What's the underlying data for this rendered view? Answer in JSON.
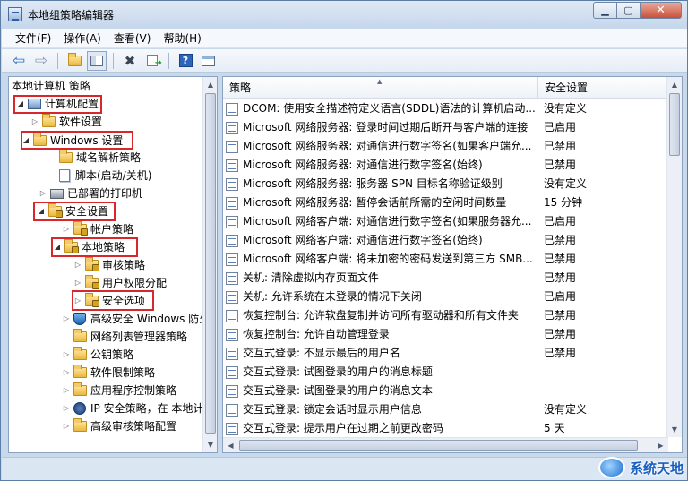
{
  "window": {
    "title": "本地组策略编辑器"
  },
  "menu": [
    "文件(F)",
    "操作(A)",
    "查看(V)",
    "帮助(H)"
  ],
  "toolbar_icons": [
    "back-arrow-icon",
    "forward-arrow-icon",
    "up-folder-icon",
    "show-hide-tree-icon",
    "delete-icon",
    "export-list-icon",
    "help-icon",
    "properties-icon"
  ],
  "tree": {
    "root": "本地计算机 策略",
    "computer_config": "计算机配置",
    "software_settings": "软件设置",
    "windows_settings": "Windows 设置",
    "dns_policy": "域名解析策略",
    "scripts": "脚本(启动/关机)",
    "printers": "已部署的打印机",
    "security_settings": "安全设置",
    "account_policies": "帐户策略",
    "local_policies": "本地策略",
    "audit_policy": "审核策略",
    "user_rights": "用户权限分配",
    "security_options": "安全选项",
    "firewall": "高级安全 Windows 防火",
    "network_list": "网络列表管理器策略",
    "public_key": "公钥策略",
    "software_restriction": "软件限制策略",
    "app_control": "应用程序控制策略",
    "ipsec": "IP 安全策略，在 本地计算",
    "advanced_audit": "高级审核策略配置"
  },
  "columns": {
    "policy": "策略",
    "setting": "安全设置"
  },
  "policies": [
    {
      "name": "DCOM: 使用安全描述符定义语言(SDDL)语法的计算机启动...",
      "setting": "没有定义"
    },
    {
      "name": "Microsoft 网络服务器: 登录时间过期后断开与客户端的连接",
      "setting": "已启用"
    },
    {
      "name": "Microsoft 网络服务器: 对通信进行数字签名(如果客户端允...",
      "setting": "已禁用"
    },
    {
      "name": "Microsoft 网络服务器: 对通信进行数字签名(始终)",
      "setting": "已禁用"
    },
    {
      "name": "Microsoft 网络服务器: 服务器 SPN 目标名称验证级别",
      "setting": "没有定义"
    },
    {
      "name": "Microsoft 网络服务器: 暂停会话前所需的空闲时间数量",
      "setting": "15 分钟"
    },
    {
      "name": "Microsoft 网络客户端: 对通信进行数字签名(如果服务器允...",
      "setting": "已启用"
    },
    {
      "name": "Microsoft 网络客户端: 对通信进行数字签名(始终)",
      "setting": "已禁用"
    },
    {
      "name": "Microsoft 网络客户端: 将未加密的密码发送到第三方 SMB...",
      "setting": "已禁用"
    },
    {
      "name": "关机: 清除虚拟内存页面文件",
      "setting": "已禁用"
    },
    {
      "name": "关机: 允许系统在未登录的情况下关闭",
      "setting": "已启用"
    },
    {
      "name": "恢复控制台: 允许软盘复制并访问所有驱动器和所有文件夹",
      "setting": "已禁用"
    },
    {
      "name": "恢复控制台: 允许自动管理登录",
      "setting": "已禁用"
    },
    {
      "name": "交互式登录: 不显示最后的用户名",
      "setting": "已禁用"
    },
    {
      "name": "交互式登录: 试图登录的用户的消息标题",
      "setting": ""
    },
    {
      "name": "交互式登录: 试图登录的用户的消息文本",
      "setting": ""
    },
    {
      "name": "交互式登录: 锁定会话时显示用户信息",
      "setting": "没有定义"
    },
    {
      "name": "交互式登录: 提示用户在过期之前更改密码",
      "setting": "5 天"
    }
  ],
  "watermark": {
    "text": "系统天地"
  }
}
